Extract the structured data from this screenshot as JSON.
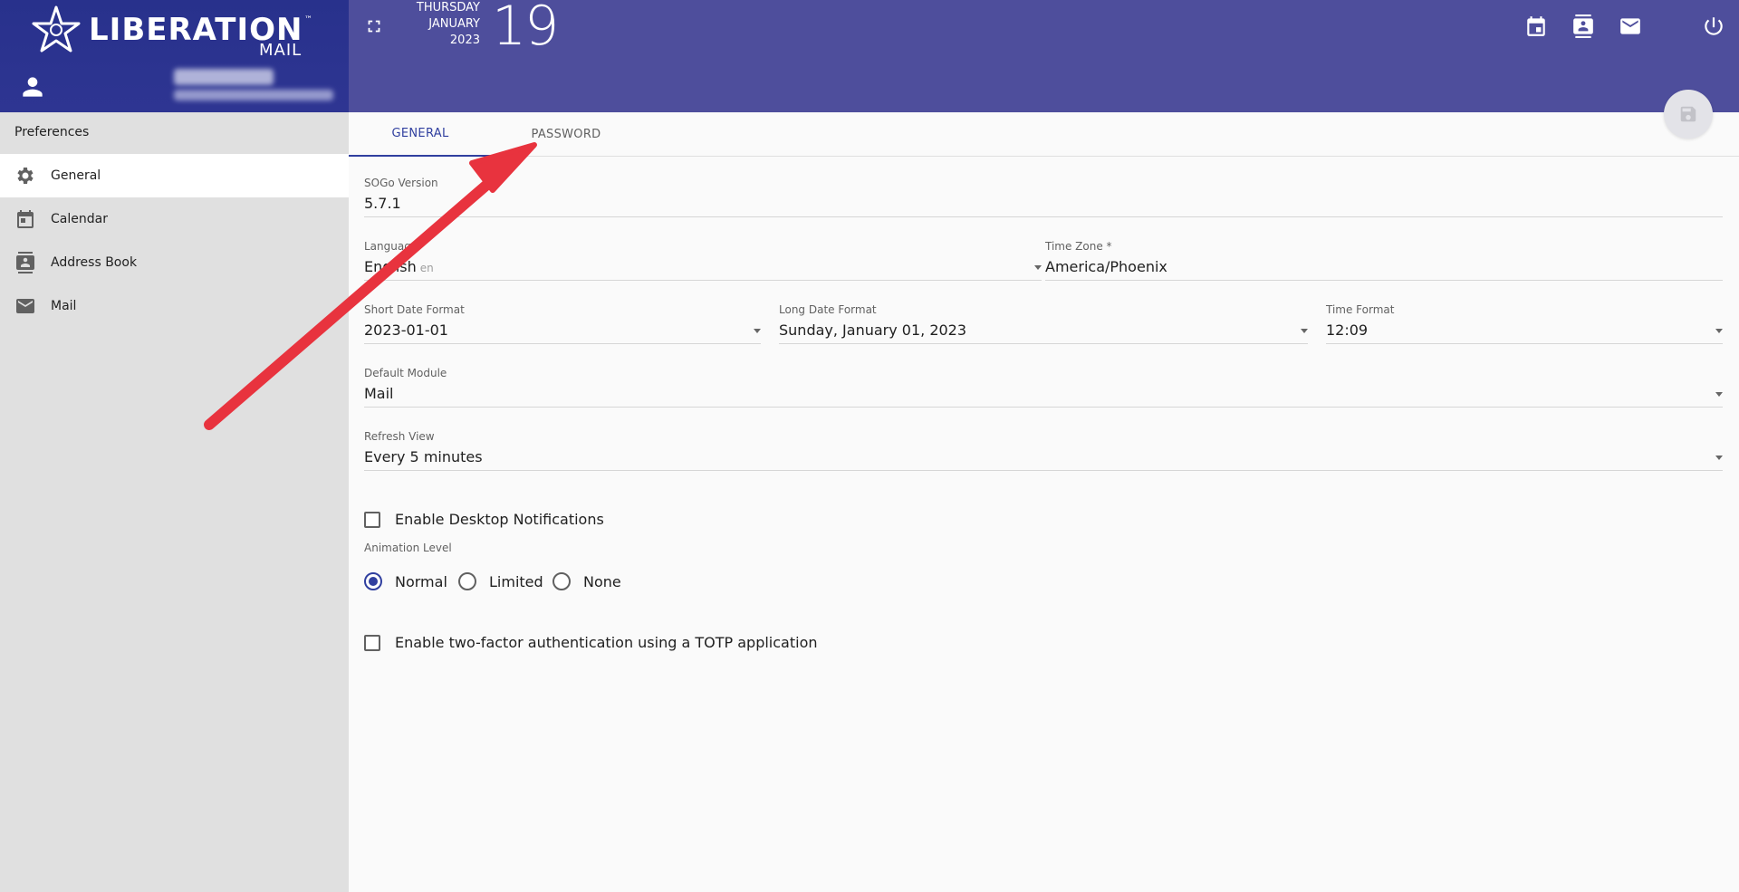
{
  "brand": {
    "wordmark": "LIBERATION",
    "sub": "MAIL",
    "tm": "™"
  },
  "sidebar": {
    "title": "Preferences",
    "items": [
      {
        "label": "General",
        "icon": "gear-icon",
        "active": true
      },
      {
        "label": "Calendar",
        "icon": "calendar-icon",
        "active": false
      },
      {
        "label": "Address Book",
        "icon": "contact-book-icon",
        "active": false
      },
      {
        "label": "Mail",
        "icon": "mail-icon",
        "active": false
      }
    ]
  },
  "header": {
    "weekday": "THURSDAY",
    "month": "JANUARY",
    "year": "2023",
    "day": "19",
    "background": "#4e4e9c",
    "sidebar_background": "#2b338f"
  },
  "tabs": [
    {
      "label": "GENERAL",
      "active": true
    },
    {
      "label": "PASSWORD",
      "active": false
    }
  ],
  "form": {
    "sogo_version": {
      "label": "SOGo Version",
      "value": "5.7.1"
    },
    "language": {
      "label": "Language",
      "value": "English",
      "hint": "en"
    },
    "time_zone": {
      "label": "Time Zone *",
      "value": "America/Phoenix"
    },
    "short_date": {
      "label": "Short Date Format",
      "value": "2023-01-01"
    },
    "long_date": {
      "label": "Long Date Format",
      "value": "Sunday, January 01, 2023"
    },
    "time_format": {
      "label": "Time Format",
      "value": "12:09"
    },
    "default_module": {
      "label": "Default Module",
      "value": "Mail"
    },
    "refresh_view": {
      "label": "Refresh View",
      "value": "Every 5 minutes"
    },
    "desktop_notifications": {
      "label": "Enable Desktop Notifications",
      "checked": false
    },
    "animation": {
      "label": "Animation Level",
      "options": [
        "Normal",
        "Limited",
        "None"
      ],
      "selected": "Normal"
    },
    "two_factor": {
      "label": "Enable two-factor authentication using a TOTP application",
      "checked": false
    }
  },
  "colors": {
    "accent": "#303f9f",
    "annotation_arrow": "#e8333e"
  }
}
